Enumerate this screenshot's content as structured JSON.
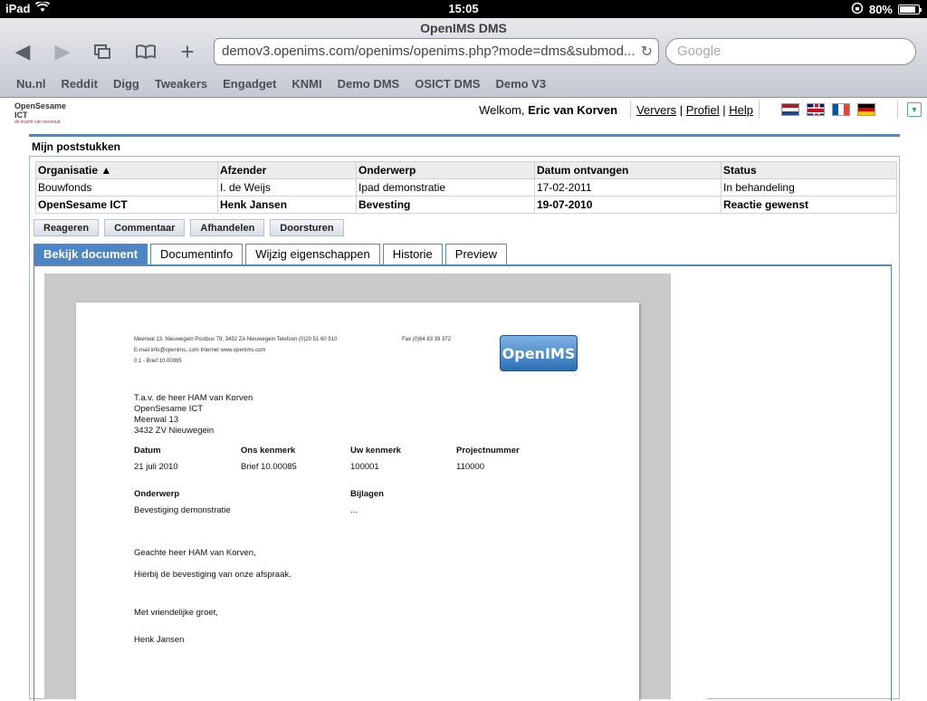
{
  "status_bar": {
    "device": "iPad",
    "time": "15:05",
    "battery": "80%"
  },
  "browser": {
    "title": "OpenIMS DMS",
    "url": "demov3.openims.com/openims/openims.php?mode=dms&submod...",
    "search_placeholder": "Google",
    "bookmarks": [
      "Nu.nl",
      "Reddit",
      "Digg",
      "Tweakers",
      "Engadget",
      "KNMI",
      "Demo DMS",
      "OSICT DMS",
      "Demo V3"
    ]
  },
  "header": {
    "logo_name": "OpenSesame ICT",
    "logo_tagline": "de kracht van eenvoud",
    "welcome_prefix": "Welkom,",
    "user_name": "Eric van Korven",
    "links": [
      "Ververs",
      "Profiel",
      "Help"
    ]
  },
  "section_title": "Mijn poststukken",
  "table": {
    "columns": [
      "Organisatie ▲",
      "Afzender",
      "Onderwerp",
      "Datum ontvangen",
      "Status"
    ],
    "rows": [
      [
        "Bouwfonds",
        "I. de Weijs",
        "Ipad demonstratie",
        "17-02-2011",
        "In behandeling"
      ],
      [
        "OpenSesame ICT",
        "Henk Jansen",
        "Bevesting",
        "19-07-2010",
        "Reactie gewenst"
      ]
    ]
  },
  "actions": [
    "Reageren",
    "Commentaar",
    "Afhandelen",
    "Doorsturen"
  ],
  "tabs": [
    "Bekijk document",
    "Documentinfo",
    "Wijzig eigenschappen",
    "Historie",
    "Preview"
  ],
  "document": {
    "header_line1": "Meerwal 13, Nieuwegein    Postbus 79, 3432 ZA Nieuwegein    Telefoon (0)20 51 60 510",
    "header_fax": "Fax   (0)84 83 39 372",
    "header_line2": "E-mail info@openims..com    Internet www.openims.com",
    "header_line3": "0.1  - Brief 10.00085",
    "logo_text": "OpenIMS",
    "address": [
      "T.a.v. de heer HAM van Korven",
      "OpenSesame ICT",
      "Meerwal 13",
      "3432 ZV  Nieuwegein"
    ],
    "labels": {
      "datum": "Datum",
      "ons_kenmerk": "Ons kenmerk",
      "uw_kenmerk": "Uw kenmerk",
      "projectnummer": "Projectnummer",
      "onderwerp": "Onderwerp",
      "bijlagen": "Bijlagen"
    },
    "values": {
      "datum": "21 juli 2010",
      "ons_kenmerk": "Brief 10.00085",
      "uw_kenmerk": "100001",
      "projectnummer": "110000",
      "onderwerp": "Bevestiging demonstratie",
      "bijlagen": "..."
    },
    "salutation": "Geachte heer HAM van Korven,",
    "body": "Hierbij de bevestiging van onze afspraak.",
    "closing": "Met vriendelijke groet,",
    "signature": "Henk Jansen"
  }
}
